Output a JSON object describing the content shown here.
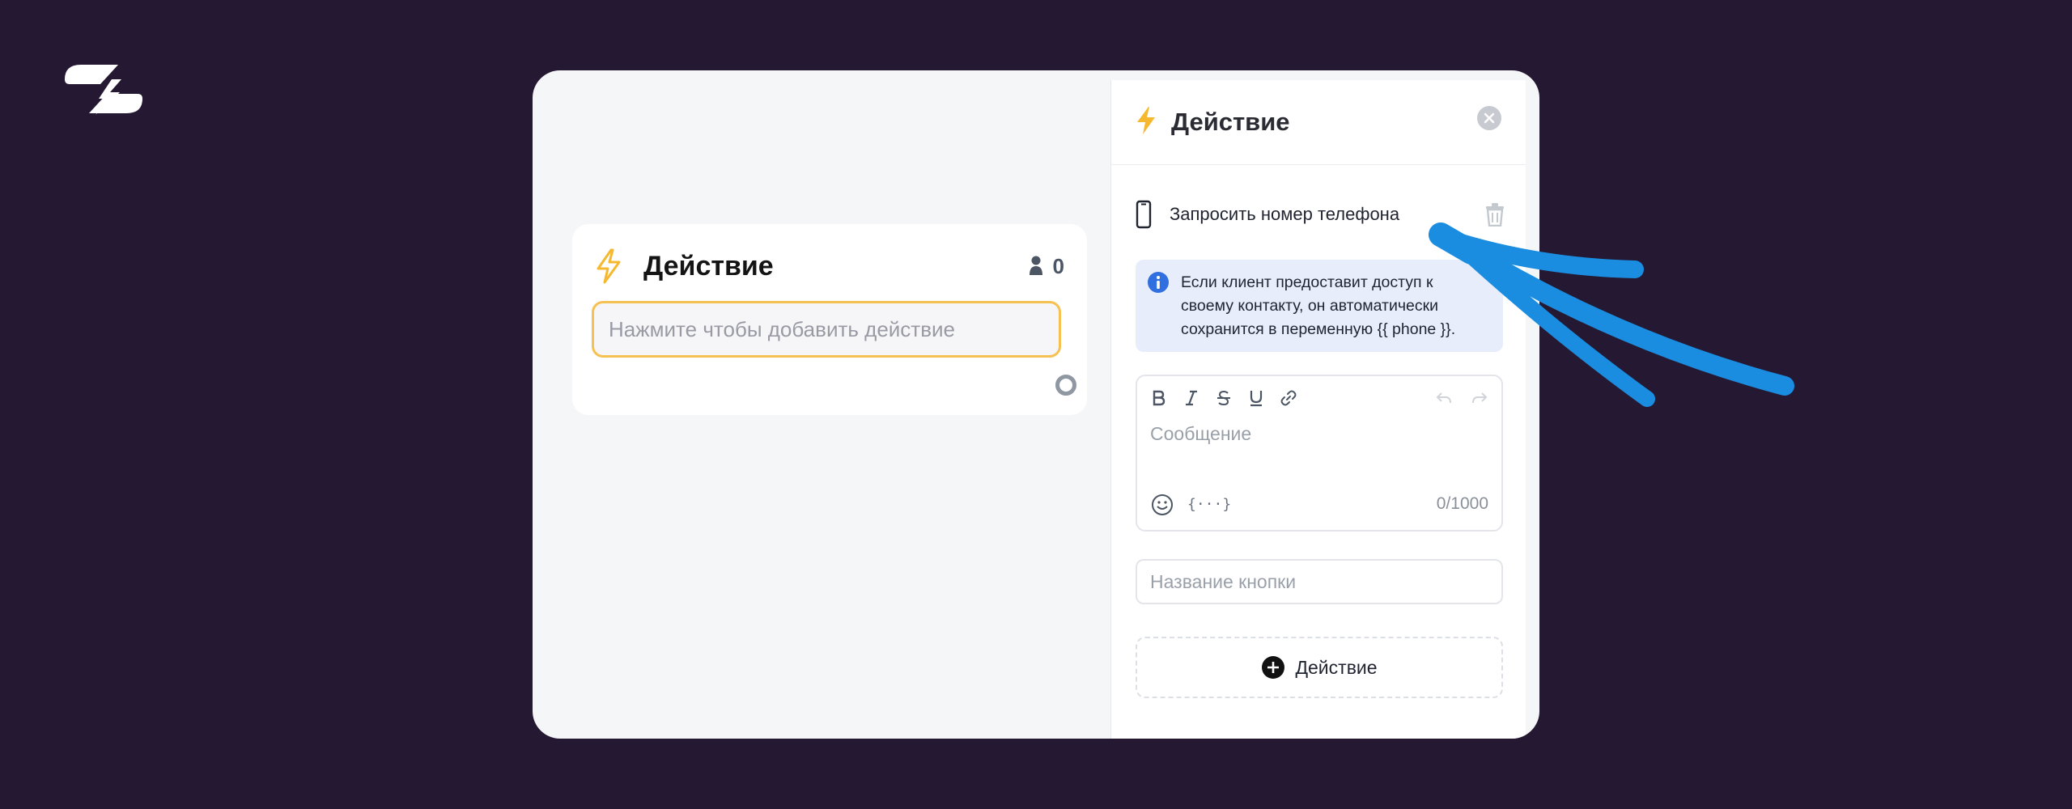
{
  "colors": {
    "background": "#251832",
    "accent_yellow": "#f5b82e",
    "arrow_blue": "#1a8de0",
    "info_bg": "#e8edfc",
    "info_icon": "#2f6fe0"
  },
  "brand": {
    "logo_icon": "bolt-brand-icon"
  },
  "node": {
    "title": "Действие",
    "user_count": "0",
    "action_placeholder": "Нажмите чтобы добавить действие"
  },
  "panel": {
    "title": "Действие",
    "request_label": "Запросить номер телефона",
    "info_lines": [
      "Если клиент предоставит доступ к",
      "своему контакту, он автоматически",
      "сохранится в переменную {{ phone }}."
    ],
    "message_placeholder": "Сообщение",
    "variables_label": "{···}",
    "char_counter": "0/1000",
    "button_name_placeholder": "Название кнопки",
    "add_action_label": "Действие"
  }
}
